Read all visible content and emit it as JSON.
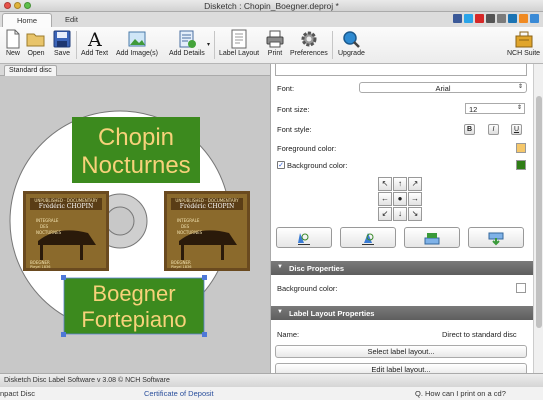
{
  "window": {
    "title": "Disketch : Chopin_Boegner.deproj *"
  },
  "menu_tabs": [
    {
      "label": "Home"
    },
    {
      "label": "Edit"
    }
  ],
  "toolbar": {
    "new": "New",
    "open": "Open",
    "save": "Save",
    "add_text": "Add Text",
    "add_images": "Add Image(s)",
    "add_details": "Add Details",
    "label_layout": "Label Layout",
    "print": "Print",
    "preferences": "Preferences",
    "upgrade": "Upgrade",
    "nch_suite": "NCH Suite"
  },
  "document_tab": "Standard disc",
  "disc": {
    "title_line1": "Chopin",
    "title_line2": "Nocturnes",
    "subtitle_line1": "Boegner",
    "subtitle_line2": "Fortepiano",
    "title_bg": "#3c8a1e",
    "title_text_color": "#f7d27a",
    "cover_art": {
      "header": "UNPUBLISHED · DOCUMENTARY",
      "composer": "Frédéric CHOPIN",
      "work_line1": "INTEGRALE",
      "work_line2": "DES",
      "work_line3": "NOCTURNES",
      "performer": "BOEGNER",
      "instrument": "Pleyel 1836"
    }
  },
  "properties": {
    "font_label": "Font:",
    "font_value": "Arial",
    "font_size_label": "Font size:",
    "font_size_value": "12",
    "font_style_label": "Font style:",
    "bold": "B",
    "italic": "I",
    "underline": "U",
    "foreground_label": "Foreground color:",
    "foreground_color": "#f5c76a",
    "background_label": "Background color:",
    "background_color": "#2f7d16",
    "background_checked": true
  },
  "disc_properties": {
    "header": "Disc Properties",
    "background_label": "Background color:"
  },
  "label_layout": {
    "header": "Label Layout Properties",
    "name_label": "Name:",
    "name_value": "Direct to standard disc",
    "select_button": "Select label layout...",
    "edit_button": "Edit label layout..."
  },
  "status": {
    "text": "Disketch Disc Label Software v 3.08 © NCH Software"
  },
  "background_window": {
    "left_text": "npact Disc",
    "center_text": "Certificate of Deposit",
    "right_text": "Q. How can I print on a cd?"
  }
}
